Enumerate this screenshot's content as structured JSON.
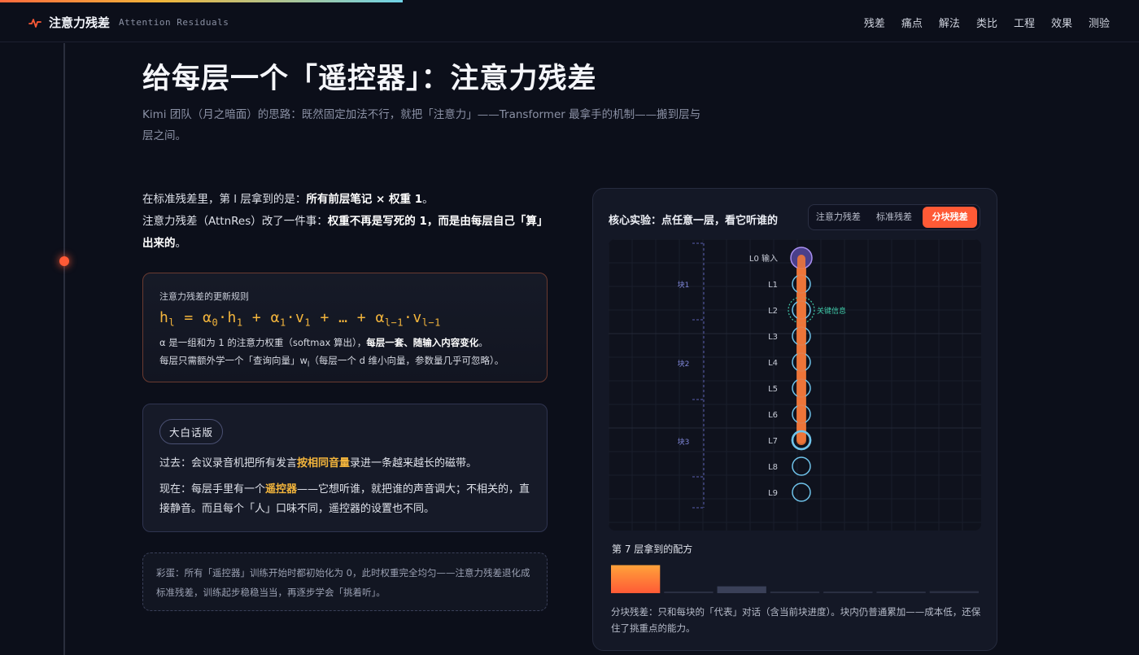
{
  "header": {
    "brand_title": "注意力残差",
    "brand_subtitle": "Attention Residuals",
    "brand_icon": "pulse-icon",
    "nav": [
      "残差",
      "痛点",
      "解法",
      "类比",
      "工程",
      "效果",
      "测验"
    ]
  },
  "page": {
    "title": "给每层一个「遥控器」：注意力残差",
    "subtitle": "Kimi 团队（月之暗面）的思路：既然固定加法不行，就把「注意力」——Transformer 最拿手的机制——搬到层与层之间。"
  },
  "intro": {
    "line1_prefix": "在标准残差里，第 l 层拿到的是：",
    "line1_bold": "所有前层笔记 × 权重 1",
    "line1_suffix": "。",
    "line2_prefix": "注意力残差（AttnRes）改了一件事：",
    "line2_bold": "权重不再是写死的 1，而是由每层自己「算」出来的",
    "line2_suffix": "。"
  },
  "formula_card": {
    "label": "注意力残差的更新规则",
    "note1_prefix": "α 是一组和为 1 的注意力权重（softmax 算出），",
    "note1_bold": "每层一套、随输入内容变化",
    "note1_suffix": "。",
    "note2": "每层只需额外学一个「查询向量」w"
  },
  "plain_card": {
    "chip": "大白话版",
    "p1_prefix": "过去：会议录音机把所有发言",
    "p1_highlight": "按相同音量",
    "p1_suffix": "录进一条越来越长的磁带。",
    "p2_prefix": "现在：每层手里有一个",
    "p2_highlight": "遥控器",
    "p2_suffix": "——它想听谁，就把谁的声音调大；不相关的，直接静音。而且每个「人」口味不同，遥控器的设置也不同。"
  },
  "egg_card": {
    "text": "彩蛋：所有「遥控器」训练开始时都初始化为 0，此时权重完全均匀——注意力残差退化成标准残差，训练起步稳稳当当，再逐步学会「挑着听」。"
  },
  "experiment": {
    "title": "核心实验：点任意一层，看它听谁的",
    "modes": [
      "注意力残差",
      "标准残差",
      "分块残差"
    ],
    "active_mode": "分块残差",
    "layers": [
      "L0 输入",
      "L1",
      "L2",
      "L3",
      "L4",
      "L5",
      "L6",
      "L7",
      "L8",
      "L9"
    ],
    "selected_layer": "L7",
    "key_layer": "L2",
    "key_label": "关键信息",
    "blocks": [
      "块1",
      "块2",
      "块3"
    ],
    "recipe_title": "第 7 层拿到的配方",
    "recipe_weights": [
      0.82,
      0.02,
      0.2,
      0.02,
      0.02,
      0.02,
      0.06
    ],
    "recipe_note": "分块残差：只和每块的「代表」对话（含当前块进度）。块内仍普通累加——成本低，还保住了挑重点的能力。",
    "colors": {
      "accent": "#ff5a36",
      "ring": "#6fc3ea",
      "key": "#3fc9a8",
      "bar": "#ff8a3a"
    }
  }
}
